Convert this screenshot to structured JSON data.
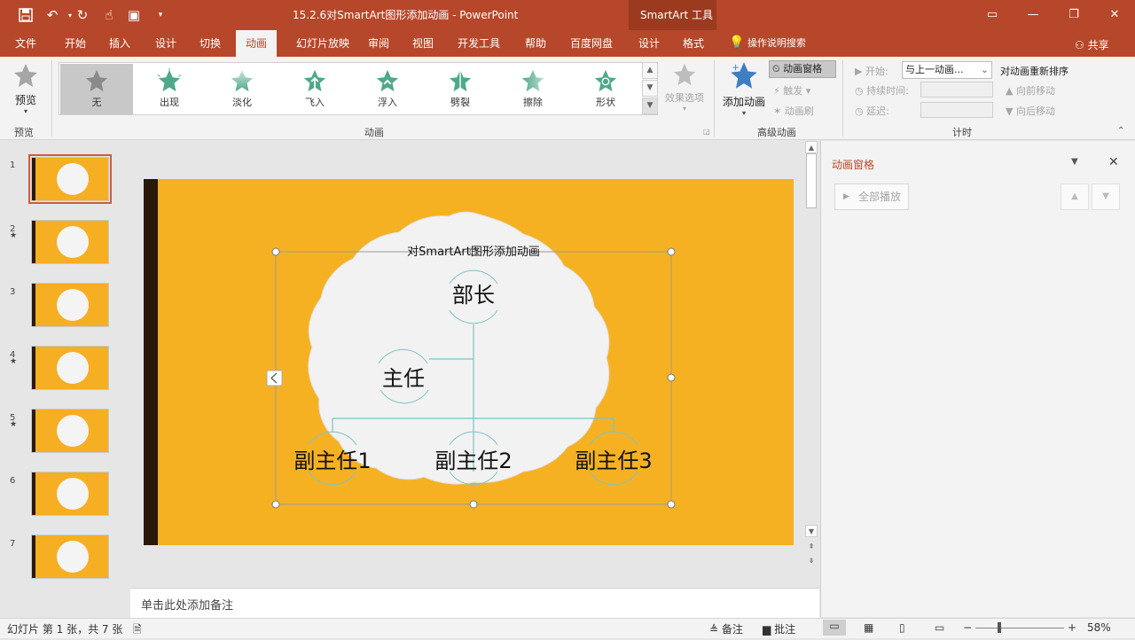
{
  "titlebar": {
    "title": "15.2.6对SmartArt图形添加动画 - PowerPoint",
    "contextual_label": "SmartArt 工具",
    "quick_access": [
      "save-icon",
      "undo-icon",
      "redo-icon",
      "touch-mode-icon",
      "start-from-beginning-icon",
      "customize-icon"
    ]
  },
  "tabs": [
    "文件",
    "开始",
    "插入",
    "设计",
    "切换",
    "动画",
    "幻灯片放映",
    "审阅",
    "视图",
    "开发工具",
    "帮助",
    "百度网盘",
    "设计",
    "格式"
  ],
  "active_tab": "动画",
  "tellme": "操作说明搜索",
  "share": "共享",
  "ribbon": {
    "preview": {
      "label": "预览",
      "group": "预览"
    },
    "animation_group": "动画",
    "effects": [
      "无",
      "出现",
      "淡化",
      "飞入",
      "浮入",
      "劈裂",
      "擦除",
      "形状"
    ],
    "effect_options": "效果选项",
    "advanced": {
      "group": "高级动画",
      "add_animation": "添加动画",
      "animation_pane": "动画窗格",
      "trigger": "触发",
      "animation_painter": "动画刷"
    },
    "timing": {
      "group": "计时",
      "start_label": "开始:",
      "start_value": "与上一动画...",
      "duration_label": "持续时间:",
      "delay_label": "延迟:",
      "reorder_title": "对动画重新排序",
      "move_earlier": "向前移动",
      "move_later": "向后移动"
    }
  },
  "thumbnails": {
    "numbers": [
      "1",
      "2",
      "3",
      "4",
      "5",
      "6",
      "7"
    ],
    "star_marks": [
      "★",
      "★",
      "★"
    ]
  },
  "slide": {
    "title": "对SmartArt图形添加动画",
    "nodes": {
      "top": "部长",
      "assistant": "主任",
      "sub1": "副主任1",
      "sub2": "副主任2",
      "sub3": "副主任3"
    },
    "colors": {
      "background": "#f6b123",
      "cloud": "#f2f2f2",
      "connector": "#7ec3c8"
    }
  },
  "notes_placeholder": "单击此处添加备注",
  "animation_pane": {
    "title": "动画窗格",
    "play_all": "全部播放"
  },
  "statusbar": {
    "slide_info": "幻灯片 第 1 张，共 7 张",
    "notes": "备注",
    "comments": "批注",
    "zoom": "58%"
  }
}
